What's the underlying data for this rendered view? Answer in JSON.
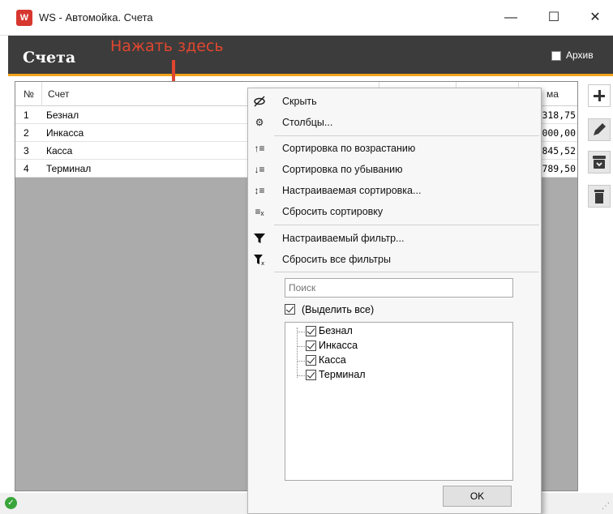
{
  "window": {
    "app_icon": "W",
    "title": "WS - Автомойка. Счета",
    "minimize": "—",
    "maximize": "☐",
    "close": "✕"
  },
  "header": {
    "title": "Счета",
    "archive_label": "Архив",
    "archive_checked": false
  },
  "annotation": {
    "text": "Нажать здесь",
    "color": "#e0462f"
  },
  "grid": {
    "columns": [
      "№",
      "Счет",
      "ма"
    ],
    "rows": [
      {
        "num": "1",
        "name": "Безнал",
        "amount": "318,75"
      },
      {
        "num": "2",
        "name": "Инкасса",
        "amount": "000,00"
      },
      {
        "num": "3",
        "name": "Касса",
        "amount": "845,52"
      },
      {
        "num": "4",
        "name": "Терминал",
        "amount": "789,50"
      }
    ]
  },
  "toolbar": {
    "add_icon": "plus-icon",
    "edit_icon": "pencil-icon",
    "archive_icon": "archive-box-icon",
    "delete_icon": "trash-icon"
  },
  "menu": {
    "items": [
      {
        "icon": "eye-slash-icon",
        "label": "Скрыть"
      },
      {
        "icon": "gear-icon",
        "label": "Столбцы..."
      },
      {
        "icon": "sort-ascending-icon",
        "label": "Сортировка по возрастанию"
      },
      {
        "icon": "sort-descending-icon",
        "label": "Сортировка по убыванию"
      },
      {
        "icon": "custom-sort-icon",
        "label": "Настраиваемая сортировка..."
      },
      {
        "icon": "clear-sort-icon",
        "label": "Сбросить сортировку"
      },
      {
        "icon": "filter-icon",
        "label": "Настраиваемый фильтр..."
      },
      {
        "icon": "clear-filter-icon",
        "label": "Сбросить все фильтры"
      }
    ],
    "search_placeholder": "Поиск",
    "select_all_label": "(Выделить все)",
    "select_all_checked": true,
    "filter_values": [
      {
        "label": "Безнал",
        "checked": true
      },
      {
        "label": "Инкасса",
        "checked": true
      },
      {
        "label": "Касса",
        "checked": true
      },
      {
        "label": "Терминал",
        "checked": true
      }
    ],
    "ok_label": "OK"
  },
  "status": {
    "ok_icon": "check-circle-icon",
    "ok_color": "#3aa53a"
  },
  "colors": {
    "header_bg": "#3c3c3c",
    "accent": "#f3a31c",
    "grid_bg": "#ababab"
  }
}
